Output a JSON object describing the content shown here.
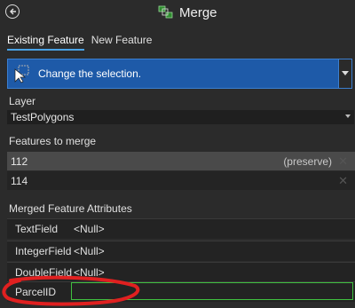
{
  "header": {
    "title": "Merge"
  },
  "tabs": [
    {
      "label": "Existing Feature"
    },
    {
      "label": "New Feature"
    }
  ],
  "tool": {
    "label": "Change the selection."
  },
  "layer": {
    "heading": "Layer",
    "value": "TestPolygons"
  },
  "features": {
    "heading": "Features to merge",
    "rows": [
      {
        "value": "112",
        "note": "(preserve)"
      },
      {
        "value": "114",
        "note": ""
      }
    ]
  },
  "attributes": {
    "heading": "Merged Feature Attributes",
    "rows": [
      {
        "name": "TextField",
        "value": "<Null>"
      },
      {
        "name": "IntegerField",
        "value": "<Null>"
      },
      {
        "name": "DoubleField",
        "value": "<Null>"
      },
      {
        "name": "ParcelID",
        "value": ""
      }
    ]
  },
  "colors": {
    "accent": "#4aa3e6",
    "tool_bg": "#1e5aa8",
    "highlight": "#3fbf3f",
    "annotation": "#e02020"
  }
}
